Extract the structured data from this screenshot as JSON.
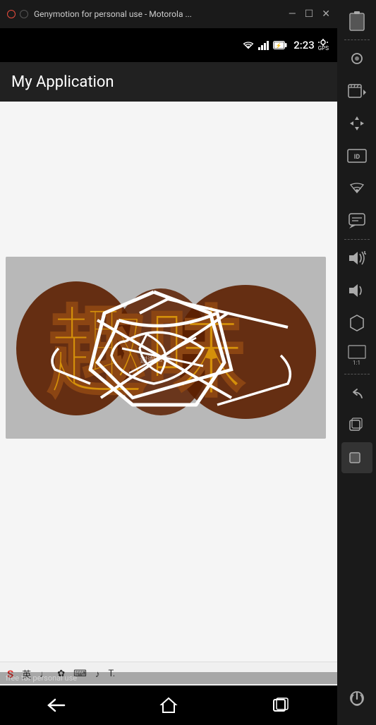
{
  "titlebar": {
    "text": "Genymotion for personal use - Motorola ...",
    "circles": [
      "",
      "",
      ""
    ],
    "controls": [
      "—",
      "☐",
      "✕"
    ]
  },
  "statusbar": {
    "time": "2:23",
    "wifi": "📶",
    "signal": "📶",
    "battery": "🔋",
    "gps": "GPS"
  },
  "appbar": {
    "title": "My Application"
  },
  "image": {
    "small_text": "谢谢声页"
  },
  "navbar": {
    "back": "←",
    "home": "⌂",
    "recents": "▭"
  },
  "watermark": {
    "text": "free for personal use"
  },
  "ime": {
    "items": [
      "S",
      "英",
      "♩",
      "✿",
      "⌨",
      "🎵",
      "T",
      "."
    ]
  },
  "sidebar": {
    "icons": [
      {
        "name": "battery-icon",
        "symbol": "🔋",
        "label": ""
      },
      {
        "name": "camera-icon",
        "symbol": "⏺",
        "label": ""
      },
      {
        "name": "video-icon",
        "symbol": "🎬",
        "label": ""
      },
      {
        "name": "move-icon",
        "symbol": "✛",
        "label": ""
      },
      {
        "name": "id-icon",
        "symbol": "ID",
        "label": ""
      },
      {
        "name": "wifi-sidebar-icon",
        "symbol": "📡",
        "label": ""
      },
      {
        "name": "message-icon",
        "symbol": "💬",
        "label": ""
      },
      {
        "name": "volume-up-icon",
        "symbol": "🔊+",
        "label": ""
      },
      {
        "name": "volume-down-icon",
        "symbol": "🔉",
        "label": ""
      },
      {
        "name": "rotate-icon",
        "symbol": "⬡",
        "label": ""
      },
      {
        "name": "ratio-icon",
        "symbol": "1:1",
        "label": ""
      },
      {
        "name": "back-sidebar-icon",
        "symbol": "↩",
        "label": ""
      },
      {
        "name": "recents-sidebar-icon",
        "symbol": "▭",
        "label": ""
      },
      {
        "name": "home-sidebar-icon",
        "symbol": "⌂",
        "label": ""
      },
      {
        "name": "power-icon",
        "symbol": "⏻",
        "label": ""
      }
    ]
  }
}
